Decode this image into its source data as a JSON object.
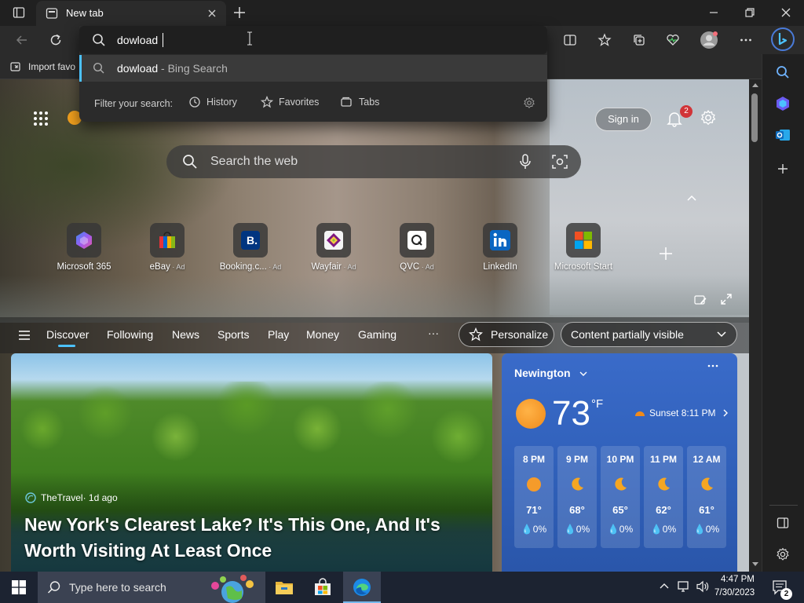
{
  "browser": {
    "tab": {
      "title": "New tab",
      "icon": "new-tab-page-icon"
    },
    "window_controls": [
      "minimize-icon",
      "restore-icon",
      "close-icon"
    ],
    "address_bar": {
      "value": "dowload"
    },
    "suggestion": {
      "query": "dowload",
      "source": " - Bing Search"
    },
    "filter": {
      "label": "Filter your search:",
      "options": [
        "History",
        "Favorites",
        "Tabs"
      ]
    },
    "favorites_bar": {
      "import_label": "Import favo"
    }
  },
  "newtab": {
    "search_placeholder": "Search the web",
    "sign_in": "Sign in",
    "notification_count": "2",
    "quick_links": [
      {
        "label": "Microsoft 365",
        "ad": ""
      },
      {
        "label": "eBay",
        "ad": " · Ad"
      },
      {
        "label": "Booking.c...",
        "ad": " · Ad"
      },
      {
        "label": "Wayfair",
        "ad": " · Ad"
      },
      {
        "label": "QVC",
        "ad": " · Ad"
      },
      {
        "label": "LinkedIn",
        "ad": ""
      },
      {
        "label": "Microsoft Start",
        "ad": ""
      }
    ],
    "feed_nav": {
      "items": [
        "Discover",
        "Following",
        "News",
        "Sports",
        "Play",
        "Money",
        "Gaming"
      ],
      "more": "···",
      "personalize": "Personalize",
      "content_visibility": "Content partially visible"
    },
    "article": {
      "source": "TheTravel",
      "age": " · 1d ago",
      "title": "New York's Clearest Lake? It's This One, And It's Worth Visiting At Least Once"
    },
    "weather": {
      "city": "Newington",
      "temp": "73",
      "unit": "°F",
      "sunset": "Sunset 8:11 PM",
      "hours": [
        {
          "time": "8 PM",
          "icon": "sun-icon",
          "temp": "71°",
          "precip": "0%"
        },
        {
          "time": "9 PM",
          "icon": "moon-icon",
          "temp": "68°",
          "precip": "0%"
        },
        {
          "time": "10 PM",
          "icon": "moon-icon",
          "temp": "65°",
          "precip": "0%"
        },
        {
          "time": "11 PM",
          "icon": "moon-icon",
          "temp": "62°",
          "precip": "0%"
        },
        {
          "time": "12 AM",
          "icon": "moon-icon",
          "temp": "61°",
          "precip": "0%"
        }
      ]
    }
  },
  "taskbar": {
    "search_placeholder": "Type here to search",
    "time": "4:47 PM",
    "date": "7/30/2023",
    "notifications": "2"
  },
  "colors": {
    "accent": "#4cc2ff",
    "weather_card": "#3263bd",
    "taskbar": "#1c2331"
  }
}
